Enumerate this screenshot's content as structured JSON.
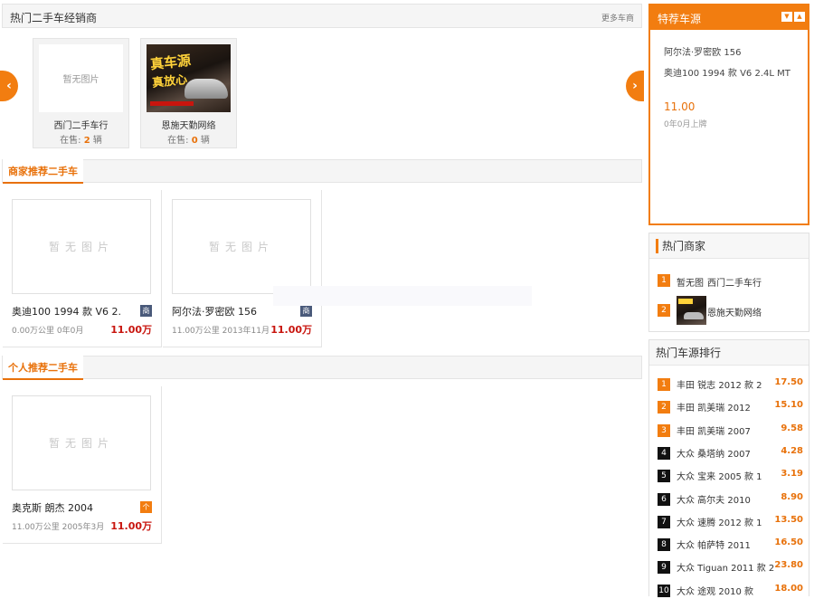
{
  "colors": {
    "accent": "#f27d10",
    "price_red": "#c8150e"
  },
  "dealers_section": {
    "title": "热门二手车经销商",
    "more": "更多车商",
    "dealers": [
      {
        "name": "西门二手车行",
        "on_sale_label": "在售:",
        "count": "2",
        "unit": "辆",
        "no_image": "暂无图片"
      },
      {
        "name": "恩施天勤网络",
        "on_sale_label": "在售:",
        "count": "0",
        "unit": "辆",
        "image_text_1": "真车源",
        "image_text_2": "真放心"
      }
    ]
  },
  "merchant_section": {
    "title": "商家推荐二手车",
    "cars": [
      {
        "name": "奥迪100 1994 款 V6 2.",
        "badge": "商",
        "meta": "0.00万公里  0年0月",
        "price": "11.00万",
        "no_image": "暂无图片"
      },
      {
        "name": "阿尔法·罗密欧 156",
        "badge": "商",
        "meta": "11.00万公里  2013年11月",
        "price": "11.00万",
        "no_image": "暂无图片"
      }
    ]
  },
  "personal_section": {
    "title": "个人推荐二手车",
    "cars": [
      {
        "name": "奥克斯 朗杰 2004",
        "badge": "个",
        "meta": "11.00万公里  2005年3月",
        "price": "11.00万",
        "no_image": "暂无图片"
      }
    ]
  },
  "featured": {
    "title": "特荐车源",
    "lines": [
      "阿尔法·罗密欧 156",
      "奥迪100 1994 款 V6 2.4L MT"
    ],
    "price": "11.00",
    "date": "0年0月上牌"
  },
  "hot_dealers": {
    "title": "热门商家",
    "items": [
      {
        "num": "1",
        "thumb": "暂无图",
        "name": "西门二手车行"
      },
      {
        "num": "2",
        "name": "恩施天勤网络"
      }
    ]
  },
  "hot_ranking": {
    "title": "热门车源排行",
    "items": [
      {
        "num": "1",
        "name": "丰田 锐志 2012 款 2",
        "price": "17.50"
      },
      {
        "num": "2",
        "name": "丰田 凯美瑞 2012",
        "price": "15.10"
      },
      {
        "num": "3",
        "name": "丰田 凯美瑞 2007",
        "price": "9.58"
      },
      {
        "num": "4",
        "name": "大众 桑塔纳 2007",
        "price": "4.28"
      },
      {
        "num": "5",
        "name": "大众 宝来 2005 款 1",
        "price": "3.19"
      },
      {
        "num": "6",
        "name": "大众 高尔夫 2010",
        "price": "8.90"
      },
      {
        "num": "7",
        "name": "大众 速腾 2012 款 1",
        "price": "13.50"
      },
      {
        "num": "8",
        "name": "大众 帕萨特 2011",
        "price": "16.50"
      },
      {
        "num": "9",
        "name": "大众 Tiguan 2011 款 2",
        "price": "23.80"
      },
      {
        "num": "10",
        "name": "大众 途观 2010 款",
        "price": "18.00"
      }
    ]
  }
}
